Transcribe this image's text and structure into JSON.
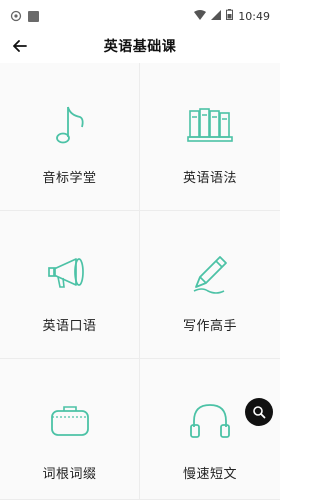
{
  "status_bar": {
    "time": "10:49"
  },
  "header": {
    "title": "英语基础课"
  },
  "menu": [
    {
      "label": "音标学堂",
      "icon": "music-note-icon"
    },
    {
      "label": "英语语法",
      "icon": "books-icon"
    },
    {
      "label": "英语口语",
      "icon": "megaphone-icon"
    },
    {
      "label": "写作高手",
      "icon": "pencil-icon"
    },
    {
      "label": "词根词缀",
      "icon": "bag-icon"
    },
    {
      "label": "慢速短文",
      "icon": "headphones-icon"
    }
  ],
  "colors": {
    "accent": "#4cc2a6",
    "background": "#fafafa"
  }
}
